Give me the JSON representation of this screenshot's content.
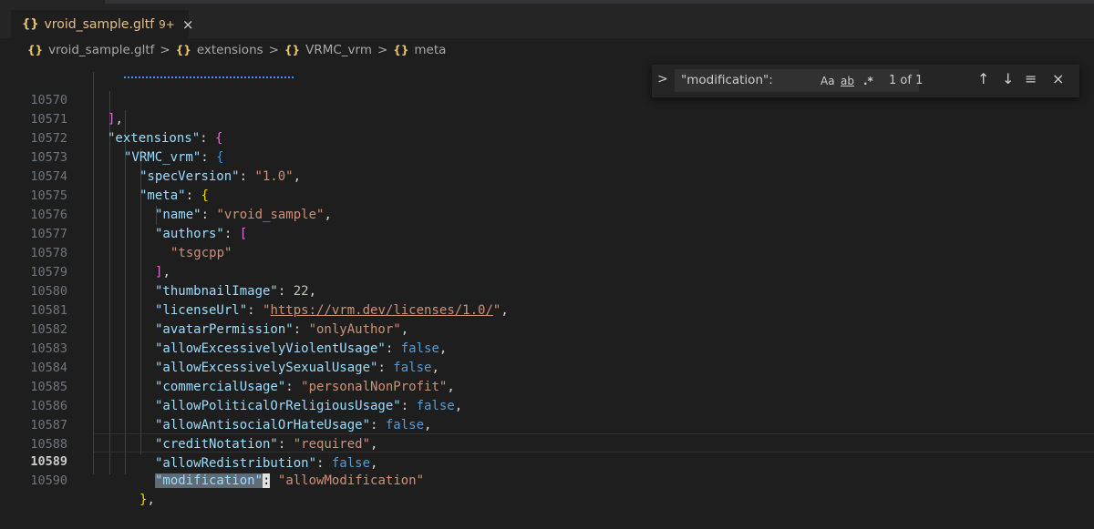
{
  "tab": {
    "icon": "json-braces-icon",
    "title": "vroid_sample.gltf",
    "badge": "9+",
    "close": "×"
  },
  "breadcrumb": [
    {
      "label": "vroid_sample.gltf"
    },
    {
      "label": "extensions"
    },
    {
      "label": "VRMC_vrm"
    },
    {
      "label": "meta"
    }
  ],
  "breadcrumb_braces": "{}",
  "breadcrumb_sep": ">",
  "find": {
    "query": "\"modification\":",
    "match_case": "Aa",
    "whole_word": "ab",
    "regex": ".*",
    "result_count": "1 of 1",
    "expand_icon": ">",
    "prev_icon": "↑",
    "next_icon": "↓",
    "selection_icon": "≡",
    "close_icon": "×"
  },
  "editor": {
    "current_line": "10589",
    "lines": [
      {
        "n": "10570",
        "text": "],"
      },
      {
        "n": "10571",
        "text": "\"extensions\": {"
      },
      {
        "n": "10572",
        "text": "\"VRMC_vrm\": {"
      },
      {
        "n": "10573",
        "text": "\"specVersion\": \"1.0\","
      },
      {
        "n": "10574",
        "text": "\"meta\": {"
      },
      {
        "n": "10575",
        "text": "\"name\": \"vroid_sample\","
      },
      {
        "n": "10576",
        "text": "\"authors\": ["
      },
      {
        "n": "10577",
        "text": "\"tsgcpp\""
      },
      {
        "n": "10578",
        "text": "],"
      },
      {
        "n": "10579",
        "text": "\"thumbnailImage\": 22,"
      },
      {
        "n": "10580",
        "text": "\"licenseUrl\": \"https://vrm.dev/licenses/1.0/\","
      },
      {
        "n": "10581",
        "text": "\"avatarPermission\": \"onlyAuthor\","
      },
      {
        "n": "10582",
        "text": "\"allowExcessivelyViolentUsage\": false,"
      },
      {
        "n": "10583",
        "text": "\"allowExcessivelySexualUsage\": false,"
      },
      {
        "n": "10584",
        "text": "\"commercialUsage\": \"personalNonProfit\","
      },
      {
        "n": "10585",
        "text": "\"allowPoliticalOrReligiousUsage\": false,"
      },
      {
        "n": "10586",
        "text": "\"allowAntisocialOrHateUsage\": false,"
      },
      {
        "n": "10587",
        "text": "\"creditNotation\": \"required\","
      },
      {
        "n": "10588",
        "text": "\"allowRedistribution\": false,"
      },
      {
        "n": "10589",
        "text": "\"modification\": \"allowModification\""
      },
      {
        "n": "10590",
        "text": "},"
      }
    ]
  },
  "colors": {
    "key": "#9cdcfe",
    "string": "#ce9178",
    "number": "#b5cea8",
    "keyword": "#569cd6",
    "bracket_gold": "#ffd700",
    "bracket_orchid": "#da70d6",
    "bracket_blue": "#179fff"
  }
}
